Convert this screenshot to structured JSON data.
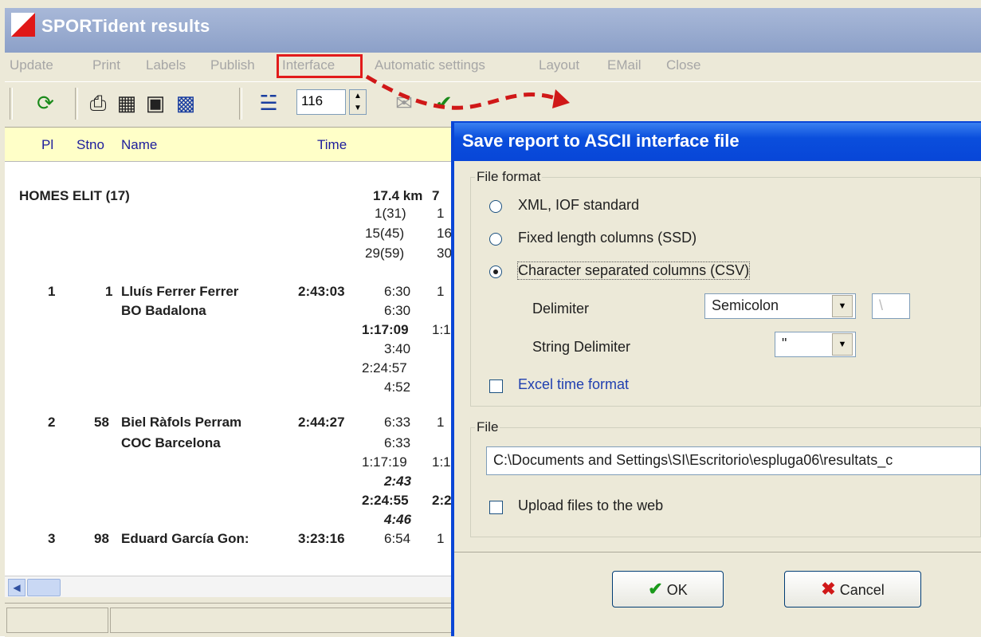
{
  "app": {
    "title": "SPORTident results"
  },
  "menu": [
    {
      "label": "Update"
    },
    {
      "label": "Print"
    },
    {
      "label": "Labels"
    },
    {
      "label": "Publish"
    },
    {
      "label": "Interface"
    },
    {
      "label": "Automatic settings"
    },
    {
      "label": "Layout"
    },
    {
      "label": "EMail"
    },
    {
      "label": "Close"
    }
  ],
  "toolbar": {
    "spin_value": "116"
  },
  "columns": {
    "pl": "Pl",
    "stno": "Stno",
    "name": "Name",
    "time": "Time"
  },
  "category": {
    "name": "HOMES ELIT  (17)",
    "distance": "17.4 km",
    "distance_tail": "7",
    "ctrl": [
      "1(31)",
      "15(45)",
      "29(59)"
    ],
    "ctrl2": [
      "1",
      "16",
      "30"
    ]
  },
  "runners": [
    {
      "pl": "1",
      "stno": "1",
      "name": "Lluís Ferrer Ferrer",
      "time": "2:43:03",
      "club": "BO Badalona",
      "splits": [
        "6:30",
        "6:30",
        "1:17:09",
        "3:40",
        "2:24:57",
        "4:52"
      ],
      "col2": [
        "1",
        "",
        "1:1",
        "",
        "",
        ""
      ]
    },
    {
      "pl": "2",
      "stno": "58",
      "name": "Biel Ràfols Perram",
      "time": "2:44:27",
      "club": "COC Barcelona",
      "splits": [
        "6:33",
        "6:33",
        "1:17:19",
        "2:43",
        "2:24:55",
        "4:46"
      ],
      "col2": [
        "1",
        "",
        "1:1",
        "",
        "2:2",
        ""
      ]
    },
    {
      "pl": "3",
      "stno": "98",
      "name": "Eduard García Gon:",
      "time": "3:23:16",
      "club": "",
      "splits": [
        "6:54"
      ],
      "col2": [
        "1"
      ]
    }
  ],
  "dialog": {
    "title": "Save report to ASCII interface file",
    "file_format_label": "File format",
    "options": [
      {
        "label": "XML, IOF standard",
        "selected": false
      },
      {
        "label": "Fixed length columns (SSD)",
        "selected": false
      },
      {
        "label": "Character separated columns (CSV)",
        "selected": true
      }
    ],
    "delimiter_label": "Delimiter",
    "delimiter_value": "Semicolon",
    "delimiter_extra": "\\",
    "string_delimiter_label": "String Delimiter",
    "string_delimiter_value": "\"",
    "excel_label": "Excel time format",
    "file_label": "File",
    "file_path": "C:\\Documents and Settings\\SI\\Escritorio\\espluga06\\resultats_c",
    "upload_label": "Upload files to the web",
    "ok_label": "OK",
    "cancel_label": "Cancel"
  },
  "colors": {
    "dialog_title": "#0a4edc",
    "highlight": "#e21b1b",
    "header_row": "#ffffc8"
  }
}
